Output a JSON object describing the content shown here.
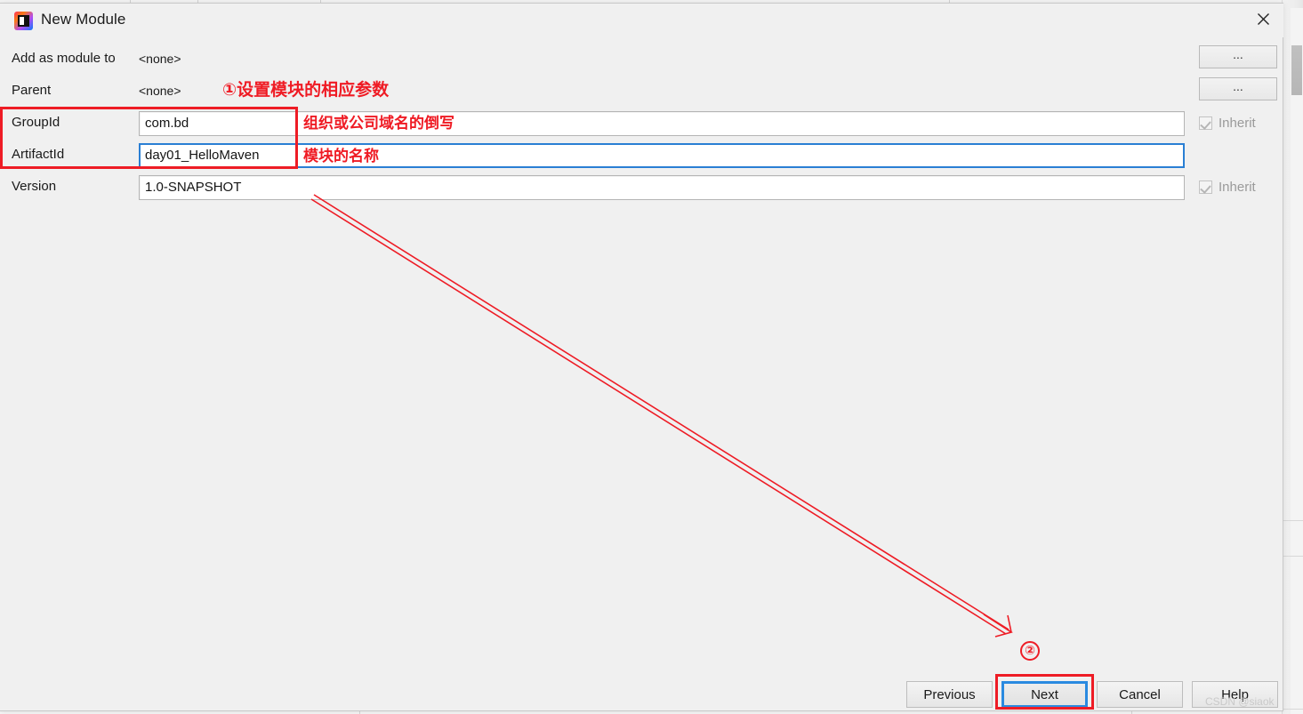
{
  "window": {
    "title": "New Module",
    "icon": "intellij-idea-icon",
    "close_icon": "close-icon"
  },
  "form": {
    "rows": [
      {
        "label": "Add as module to",
        "type": "static",
        "value": "<none>"
      },
      {
        "label": "Parent",
        "type": "static",
        "value": "<none>"
      },
      {
        "label": "GroupId",
        "type": "input",
        "value": "com.bd"
      },
      {
        "label": "ArtifactId",
        "type": "input",
        "value": "day01_HelloMaven"
      },
      {
        "label": "Version",
        "type": "input",
        "value": "1.0-SNAPSHOT"
      }
    ],
    "ellipsis_button_label": "...",
    "inherit_label": "Inherit"
  },
  "annotations": {
    "step1": "①设置模块的相应参数",
    "groupid_note": "组织或公司域名的倒写",
    "artifactid_note": "模块的名称",
    "step2": "②"
  },
  "footer": {
    "previous": "Previous",
    "next": "Next",
    "cancel": "Cancel",
    "help": "Help"
  },
  "watermark": "CSDN @siaok",
  "colors": {
    "annotation_red": "#ee1c25",
    "focus_blue": "#2a8ae0",
    "dialog_bg": "#f0f0f0"
  }
}
